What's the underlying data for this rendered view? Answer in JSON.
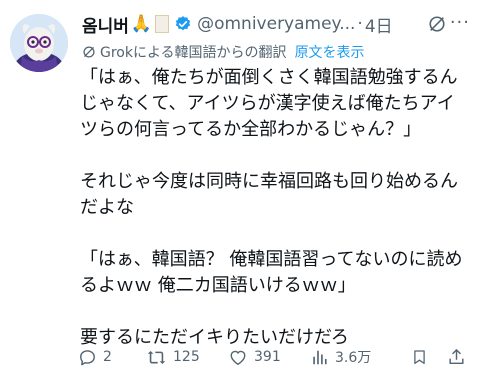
{
  "header": {
    "display_name": "옴니버",
    "name_emoji": "🙏",
    "handle": "@omniveryamey...",
    "separator": "·",
    "time": "4日",
    "more_label": "···"
  },
  "translation": {
    "label": "Grokによる韓国語からの翻訳",
    "link": "原文を表示"
  },
  "post": {
    "paragraphs": [
      "「はぁ、俺たちが面倒くさく韓国語勉強するん\nじゃなくて、アイツらが漢字使えば俺たちアイ\nツらの何言ってるか全部わかるじゃん？」",
      "それじゃ今度は同時に幸福回路も回り始めるん\nだよな",
      "「はぁ、韓国語？ 俺韓国語習ってないのに読め\nるよｗｗ 俺二カ国語いけるｗｗ」",
      "要するにただイキりたいだけだろ"
    ]
  },
  "actions": {
    "replies": "2",
    "reposts": "125",
    "likes": "391",
    "views": "3.6万"
  },
  "icons": {
    "verified": "verified-badge-icon",
    "grok": "grok-icon",
    "reply": "reply-icon",
    "repost": "repost-icon",
    "like": "heart-icon",
    "views": "views-chart-icon",
    "bookmark": "bookmark-icon",
    "share": "share-icon"
  },
  "colors": {
    "accent": "#1d9bf0",
    "muted": "#536471",
    "text": "#0f1419"
  }
}
